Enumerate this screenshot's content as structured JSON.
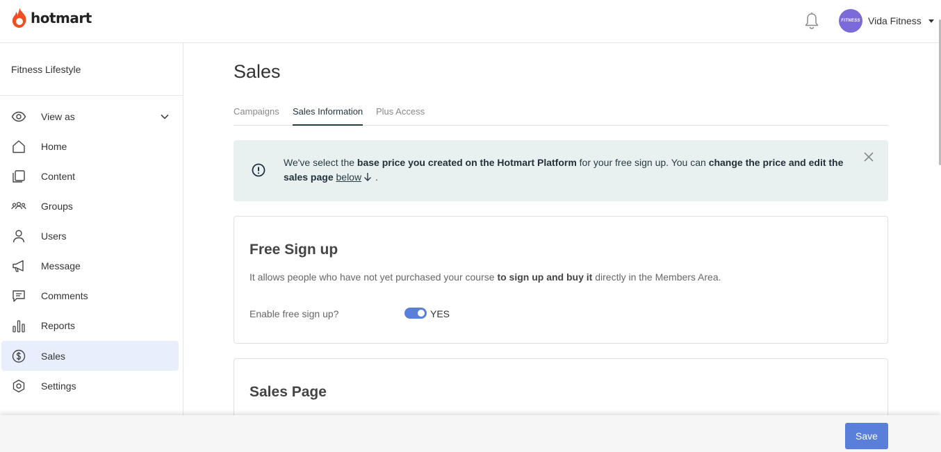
{
  "header": {
    "logo_text": "hotmart",
    "profile_name": "Vida Fitness",
    "avatar_text": "FITNESS"
  },
  "sidebar": {
    "title": "Fitness Lifestyle",
    "items": [
      {
        "label": "View as",
        "icon": "eye-icon"
      },
      {
        "label": "Home",
        "icon": "home-icon"
      },
      {
        "label": "Content",
        "icon": "content-icon"
      },
      {
        "label": "Groups",
        "icon": "groups-icon"
      },
      {
        "label": "Users",
        "icon": "user-icon"
      },
      {
        "label": "Message",
        "icon": "megaphone-icon"
      },
      {
        "label": "Comments",
        "icon": "comment-icon"
      },
      {
        "label": "Reports",
        "icon": "bar-chart-icon"
      },
      {
        "label": "Sales",
        "icon": "dollar-icon",
        "active": true
      },
      {
        "label": "Settings",
        "icon": "settings-icon"
      }
    ]
  },
  "main": {
    "title": "Sales",
    "tabs": [
      {
        "label": "Campaigns"
      },
      {
        "label": "Sales Information",
        "active": true
      },
      {
        "label": "Plus Access"
      }
    ],
    "alert": {
      "t1": "We've select the ",
      "b1": "base price you created on the Hotmart Platform",
      "t2": " for your free sign up. You can ",
      "b2": "change the price and edit the sales page",
      "t3": " ",
      "link": "below",
      "t4": " ."
    },
    "free_signup": {
      "title": "Free Sign up",
      "desc_1": "It allows people who have not yet purchased your course ",
      "desc_bold": "to sign up and buy it",
      "desc_2": " directly in the Members Area.",
      "toggle_label": "Enable free sign up?",
      "toggle_value": "YES",
      "enabled": true
    },
    "sales_page": {
      "title": "Sales Page"
    }
  },
  "footer": {
    "save_label": "Save"
  },
  "colors": {
    "accent": "#5a7fdb",
    "brand": "#f04e23",
    "alert_bg": "#e8f1f0",
    "active_nav_bg": "#e8eefc"
  }
}
